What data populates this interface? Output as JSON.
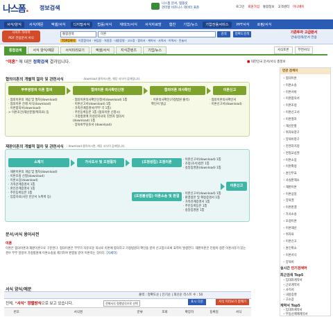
{
  "brand": {
    "logo_text": "나스폼",
    "logo_dot": ".",
    "sub": "정보검색"
  },
  "promo": {
    "line1": "나스폼 문서, 템플릿",
    "line2": "관리할 비즈니스 데이터 표준"
  },
  "util": [
    "로그인",
    "회원가입",
    "통합정보",
    "고객센터",
    "미니베이"
  ],
  "nav": [
    "서식/양식",
    "서식/예문",
    "엑셀/서식",
    "디지털서식",
    "법률/서식",
    "재테크/서식",
    "서식자료방",
    "협찬",
    "기업/뉴스",
    "기업전용서비스",
    "PPT서식",
    "로펌/서식"
  ],
  "search": {
    "left_label1": "사이트 하이어",
    "left_label2": "PDF 전용문서 서식",
    "select_value": "통합검색",
    "input_value": "이혼",
    "btn": "검색",
    "btn2": "정확도검색",
    "tags_first": "TOP검색어",
    "tags": "이혼합의서 · 위임장 · 차용증 · 내용증명 · 고소장 · 합의서 · 계약서 · 사직서 · 이력서 · 진술서",
    "right1": "기존투자 고급판서",
    "right2": "안내/검색/문서 전용"
  },
  "tabs": [
    "통합검색",
    "서식 양식/예문",
    "서식미리보기",
    "엑셀/서식",
    "지식콘텐츠",
    "기업/뉴스"
  ],
  "right_buttons": [
    "서식토론",
    "부연서식"
  ],
  "result": {
    "q": "\"이혼\"",
    "mid": " 에 대한 ",
    "k": "정확검색",
    "end": " 결과입니다."
  },
  "category": {
    "mark": "■",
    "text": "대한민국 문서/서식 총정보"
  },
  "section1": {
    "title": "협의이혼의 개별적 절차 및 관련서식",
    "desc": "· download 클릭하시면, 해당 서식이 검색됩니다.",
    "steps": [
      "부부쌍방의 이혼 합의",
      "협의이혼 의사확인신청",
      "협의이혼 의사확인",
      "이혼신고"
    ],
    "col1": [
      "· 협의이혼의 개념 및 절차(download)",
      "· 협의이혼 전제 서식(download)",
      "",
      "· 이혼합의서(download)",
      "  > 이혼조건(재산분할/위자료) 등"
    ],
    "col2": [
      "· 협의이혼의사확인신청서(download) 1통",
      "· 이혼신고서(download) 1통",
      "· 가족관계증명서(부부 각 1통)",
      "· 주민등록등본 1통 (협의이혼 신청시)",
      "· 가정법원에 미성년자녀의 친권자 협의서",
      "  (download) 1통",
      "· 양육비부담조서 (download)"
    ],
    "col3": [
      "· 이혼의사확인(가정법원 출석)",
      "  확인서 발급"
    ],
    "col4": [
      "· 협의이혼의사확인서",
      "· 이혼신고서(download)"
    ]
  },
  "section2": {
    "title": "재판이혼의 개별적 절차 및 관련서식",
    "desc": "· download 클릭하시면, 해당 서식이 검색됩니다.",
    "steps": [
      "소제기",
      "가사조사 및 조정절차",
      "(조정성립) 조정이혼",
      "이혼신고",
      "(조정불성립) 이혼소송 및 판결"
    ],
    "col1": [
      "· 재판이혼의 개념 및 절차(download)",
      "· 이혼조정 신청(download)",
      "· 이혼소장(download)",
      "· 가족관계증명서 1통",
      "· 혼인관계증명서 1통",
      "· 주민등록등본 1통",
      "· 입증자료(사진 진단서 녹취록 등)"
    ],
    "col2": [
      "· 이혼신고서(download) 1통",
      "· 조정(조서)정본 1통",
      "· 송달증명원(download) 1통"
    ],
    "col3": [
      "· 이혼신고서(download) 1통",
      "· 판결정본 및 확정증명서 1통",
      "· 가족관계증명서 1통",
      "· 주민등록등본 1통",
      "· 송달증명원 1통"
    ]
  },
  "qa": {
    "title": "문서/서식 용어사전",
    "term": "이혼",
    "body": "이혼은 협의이혼과 재판이혼으로 구분된다. 협의이혼은 부부가 자유로운 의사로 이혼에 합의하고 가정법원의 확인을 받아 신고함으로써 효력이 발생한다. 재판이혼은 민법이 정한 이혼사유가 있는 경우 부부 일방이 가정법원에 이혼소송을 제기하여 판결을 받아 이혼하는 것이다.",
    "more": "[자세히]"
  },
  "forms": {
    "title": "서식 양식/예문",
    "ctl": "출력 : 정확도순 | 인기순 | 최신순    리스트 수 : 50",
    "res_pre": "전체, ",
    "res_key": "\"서식\" 정렬방식",
    "res_post": "으로 보고 있습니다.",
    "chk": "전체서식 정렬방식으로 선택",
    "btn_pro": "표시 다운",
    "btn_save": "서식 미리보기 함께기",
    "cols": [
      "번호",
      "서식명",
      "분류",
      "조회",
      "확장자",
      "등록일",
      "서식"
    ]
  },
  "side": {
    "head": "연관 검색어",
    "items": [
      "협의이혼",
      "이혼소송",
      "이혼서류",
      "이혼합의서",
      "이혼조정",
      "이혼신고서",
      "이혼절차",
      "재산분할",
      "위자료청구",
      "양육비청구",
      "친권자지정",
      "면접교섭권",
      "이혼소장",
      "이혼확정",
      "혼인무효",
      "사실혼해소",
      "재판이혼",
      "이혼상담",
      "양육권",
      "이혼판결",
      "가사소송",
      "조정이혼",
      "이혼재산",
      "위자료",
      "이혼신고",
      "혼인취소",
      "이혼서식",
      "양육비"
    ],
    "pop_head": "실시간",
    "pop_red": "인기검색어",
    "top5_head": "최근검색 Top5",
    "top5": [
      "임대차계약서",
      "근로계약서",
      "사직서",
      "내용증명",
      "고소장"
    ],
    "top5b_head": "계약서 Top5",
    "top5b": [
      "임대차계약서",
      "부동산매매계약서",
      "근로계약서"
    ]
  }
}
